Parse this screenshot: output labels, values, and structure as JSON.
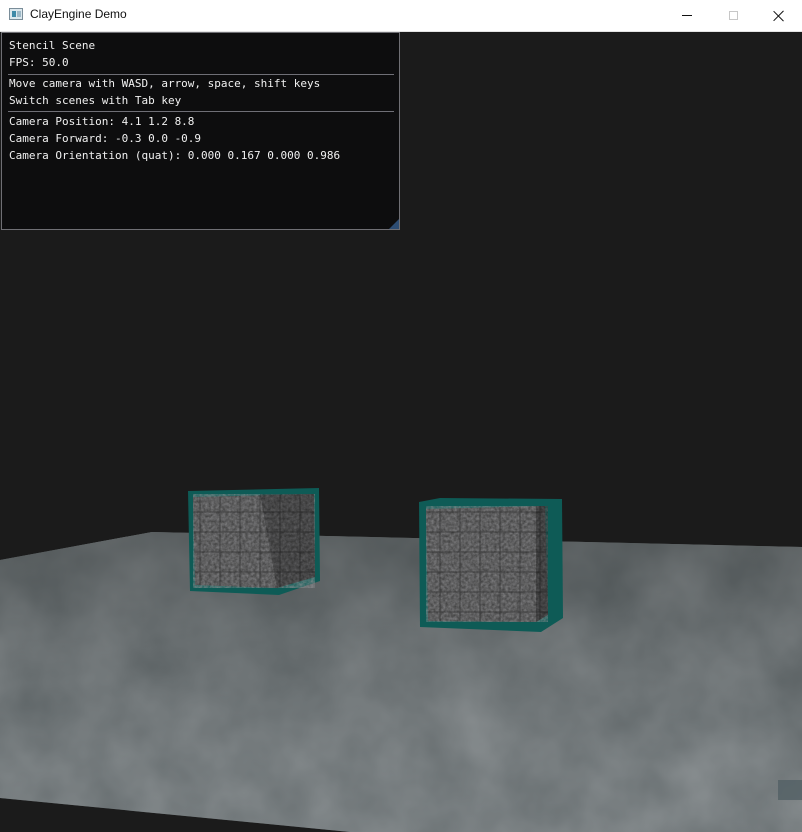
{
  "window": {
    "title": "ClayEngine Demo",
    "controls": {
      "minimize": "minimize",
      "maximize": "maximize",
      "close": "close"
    }
  },
  "overlay": {
    "scene_name": "Stencil Scene",
    "fps": "FPS: 50.0",
    "help_move": "Move camera with WASD, arrow, space, shift keys",
    "help_switch": "Switch scenes with Tab key",
    "camera_position": "Camera Position: 4.1 1.2 8.8",
    "camera_forward": "Camera Forward: -0.3 0.0 -0.9",
    "camera_orientation": "Camera Orientation (quat): 0.000 0.167 0.000 0.986"
  },
  "colors": {
    "background": "#1b1b1b",
    "outline": "#0e5b56",
    "floor": "#585e5f",
    "crate": "#3c3c3c",
    "overlay_bg": "#0c0c0e"
  }
}
